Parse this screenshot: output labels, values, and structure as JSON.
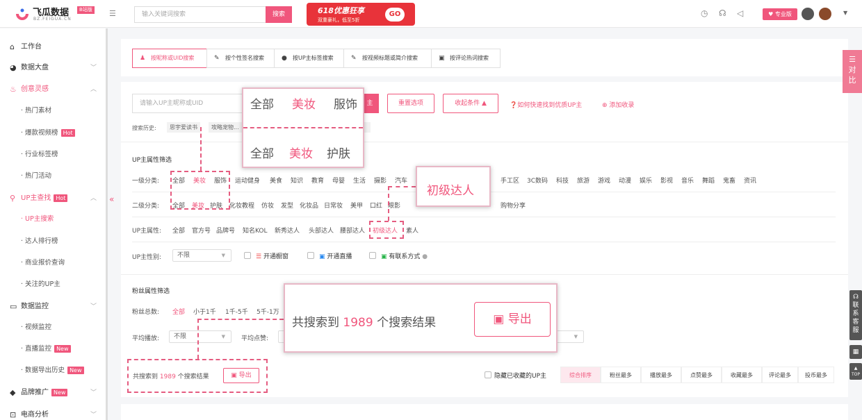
{
  "brand": {
    "name": "飞瓜数据",
    "sub_badge": "B站版",
    "domain": "BZ.FEIGUA.CN"
  },
  "header": {
    "search_placeholder": "输入关键词搜索",
    "search_button": "搜索",
    "promo_title": "618优惠狂享",
    "promo_sub": "双重豪礼，低至5折",
    "promo_go": "GO",
    "pro_badge": "专业版"
  },
  "sidebar": {
    "workbench": "工作台",
    "dashboard": "数据大盘",
    "creative": "创意灵感",
    "creative_subs": [
      "热门素材",
      "爆款视频榜",
      "行业标签榜",
      "热门活动"
    ],
    "up_search": "UP主查找",
    "up_subs": [
      "UP主搜索",
      "达人排行榜",
      "商业报价查询",
      "关注的UP主"
    ],
    "monitor": "数据监控",
    "monitor_subs": [
      "视频监控",
      "直播监控",
      "数据导出历史"
    ],
    "brand_promo": "品牌推广",
    "ecommerce": "电商分析",
    "hot": "Hot",
    "new": "New"
  },
  "tabs": [
    "按昵称或UID搜索",
    "按个性签名搜索",
    "按UP主标签搜索",
    "按视频标题或简介搜索",
    "按评论热词搜索"
  ],
  "search": {
    "placeholder": "请输入UP主昵称或UID",
    "search_suffix": "主",
    "reset": "重置选项",
    "collapse": "收起条件 ▲",
    "help": "如何快速找到优质UP主",
    "add": "添加收录",
    "history_label": "搜索历史:",
    "history": [
      "思宇爱读书",
      "攻略宠物..."
    ]
  },
  "filters": {
    "up_title": "UP主属性筛选",
    "cat1_label": "一级分类:",
    "cat1_left": [
      "全部",
      "美妆",
      "服饰",
      "运动健身",
      "美食",
      "知识",
      "教育",
      "母婴",
      "生活",
      "摄影",
      "汽车"
    ],
    "cat1_right": [
      "手工区",
      "3C数码",
      "科技",
      "旅游",
      "游戏",
      "动漫",
      "娱乐",
      "影视",
      "音乐",
      "舞蹈",
      "鬼畜",
      "资讯"
    ],
    "cat2_label": "二级分类:",
    "cat2_left": [
      "全部",
      "美妆",
      "护肤",
      "化妆教程",
      "仿妆",
      "发型",
      "化妆品",
      "日常妆",
      "美甲",
      "口红",
      "眼影"
    ],
    "cat2_right": [
      "购物分享"
    ],
    "attr_label": "UP主属性:",
    "attrs": [
      "全部",
      "官方号",
      "品牌号",
      "知名KOL",
      "新秀达人",
      "头部达人",
      "腰部达人",
      "初级达人",
      "素人"
    ],
    "gender_label": "UP主性别:",
    "gender_value": "不限",
    "checks": [
      "开通橱窗",
      "开通直播",
      "有联系方式"
    ],
    "fans_title": "粉丝属性筛选",
    "fans_label": "粉丝总数:",
    "fans_opts": [
      "全部",
      "小于1千",
      "1千-5千",
      "5千-1万"
    ],
    "avg_play_label": "平均播放:",
    "avg_play_value": "不限",
    "avg_like_label": "平均点赞:"
  },
  "results": {
    "prefix": "共搜索到",
    "count": "1989",
    "suffix": "个搜索结果",
    "export": "导出",
    "hide_fav": "隐藏已收藏的UP主"
  },
  "sorts": [
    "综合排序",
    "粉丝最多",
    "播放最多",
    "点赞最多",
    "收藏最多",
    "评论最多",
    "投币最多"
  ],
  "zooms": {
    "z1_top": [
      "全部",
      "美妆",
      "服饰"
    ],
    "z1_bottom": [
      "全部",
      "美妆",
      "护肤"
    ],
    "z2": "初级达人",
    "z3_prefix": "共搜索到",
    "z3_count": "1989",
    "z3_suffix": "个搜索结果",
    "z3_export": "导出"
  },
  "right_tools": {
    "compare": "对比",
    "service": "联系客服",
    "top": "TOP"
  },
  "colors": {
    "accent": "#f0567c"
  }
}
